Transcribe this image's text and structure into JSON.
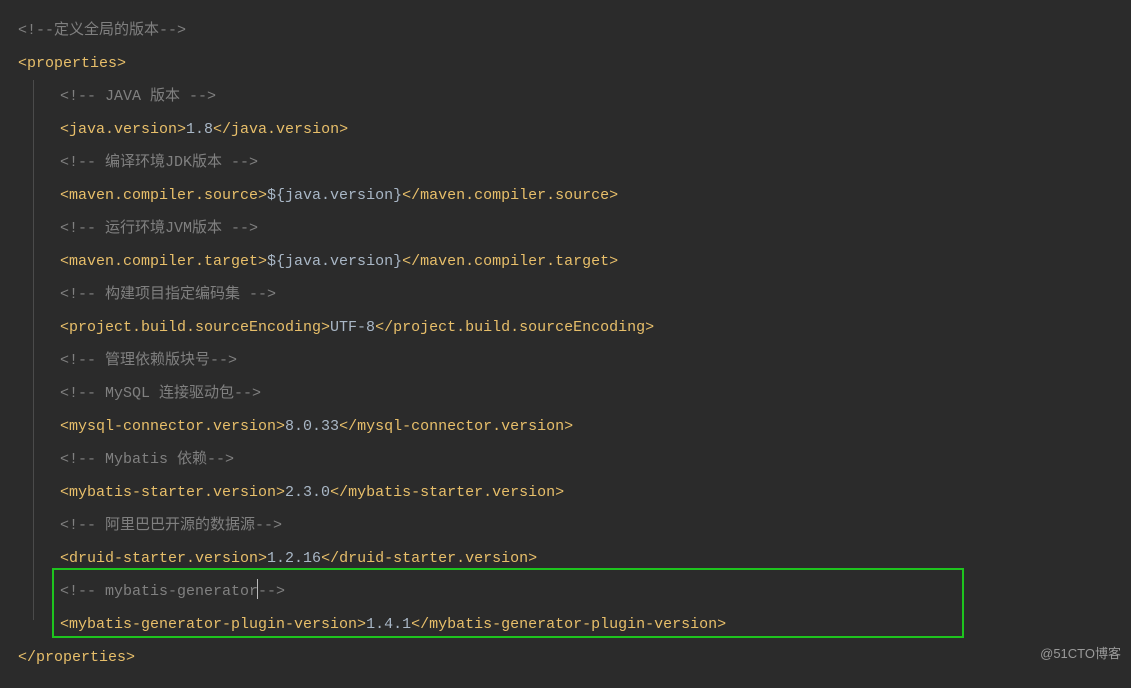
{
  "lines": {
    "l0": {
      "comment": "<!--定义全局的版本-->"
    },
    "l1": {
      "open": "<properties>"
    },
    "l2": {
      "comment": "<!-- JAVA 版本 -->"
    },
    "l3": {
      "open": "<java.version>",
      "value": "1.8",
      "close": "</java.version>"
    },
    "l4": {
      "comment": "<!-- 编译环境JDK版本 -->"
    },
    "l5": {
      "open": "<maven.compiler.source>",
      "value": "${java.version}",
      "close": "</maven.compiler.source>"
    },
    "l6": {
      "comment": "<!-- 运行环境JVM版本 -->"
    },
    "l7": {
      "open": "<maven.compiler.target>",
      "value": "${java.version}",
      "close": "</maven.compiler.target>"
    },
    "l8": {
      "comment": "<!-- 构建项目指定编码集 -->"
    },
    "l9": {
      "open": "<project.build.sourceEncoding>",
      "value": "UTF-8",
      "close": "</project.build.sourceEncoding>"
    },
    "l10": {
      "comment": "<!-- 管理依赖版块号-->"
    },
    "l11": {
      "comment": "<!-- MySQL 连接驱动包-->"
    },
    "l12": {
      "open": "<mysql-connector.version>",
      "value": "8.0.33",
      "close": "</mysql-connector.version>"
    },
    "l13": {
      "comment": "<!-- Mybatis 依赖-->"
    },
    "l14": {
      "open": "<mybatis-starter.version>",
      "value": "2.3.0",
      "close": "</mybatis-starter.version>"
    },
    "l15": {
      "comment": "<!-- 阿里巴巴开源的数据源-->"
    },
    "l16": {
      "open": "<druid-starter.version>",
      "value": "1.2.16",
      "close": "</druid-starter.version>"
    },
    "l17": {
      "commentA": "<!-- mybatis-generator",
      "commentB": "-->"
    },
    "l18": {
      "open": "<mybatis-generator-plugin-version>",
      "value": "1.4.1",
      "close": "</mybatis-generator-plugin-version>"
    },
    "l19": {
      "close": "</properties>"
    }
  },
  "watermark": "@51CTO博客"
}
